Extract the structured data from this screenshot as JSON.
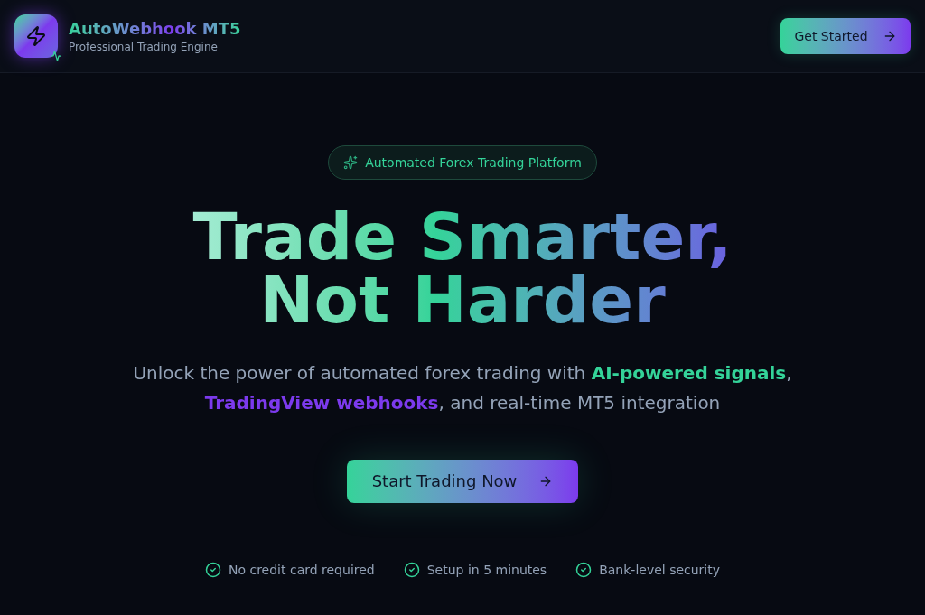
{
  "header": {
    "brand": {
      "title": "AutoWebhook MT5",
      "subtitle": "Professional Trading Engine"
    },
    "cta": {
      "label": "Get Started"
    }
  },
  "hero": {
    "badge": "Automated Forex Trading Platform",
    "headline": [
      "Trade Smarter,",
      "Not Harder"
    ],
    "description": [
      {
        "kind": "plain",
        "text": "Unlock the power of automated forex trading with "
      },
      {
        "kind": "highlight",
        "text": "AI-powered signals",
        "color": "#34d399"
      },
      {
        "kind": "plain",
        "text": ", "
      },
      {
        "kind": "highlight",
        "text": "TradingView webhooks",
        "color": "#7c3aed"
      },
      {
        "kind": "plain",
        "text": ", and real-time MT5 integration"
      }
    ],
    "cta": {
      "label": "Start Trading Now"
    },
    "features": [
      "No credit card required",
      "Setup in 5 minutes",
      "Bank-level security"
    ]
  }
}
